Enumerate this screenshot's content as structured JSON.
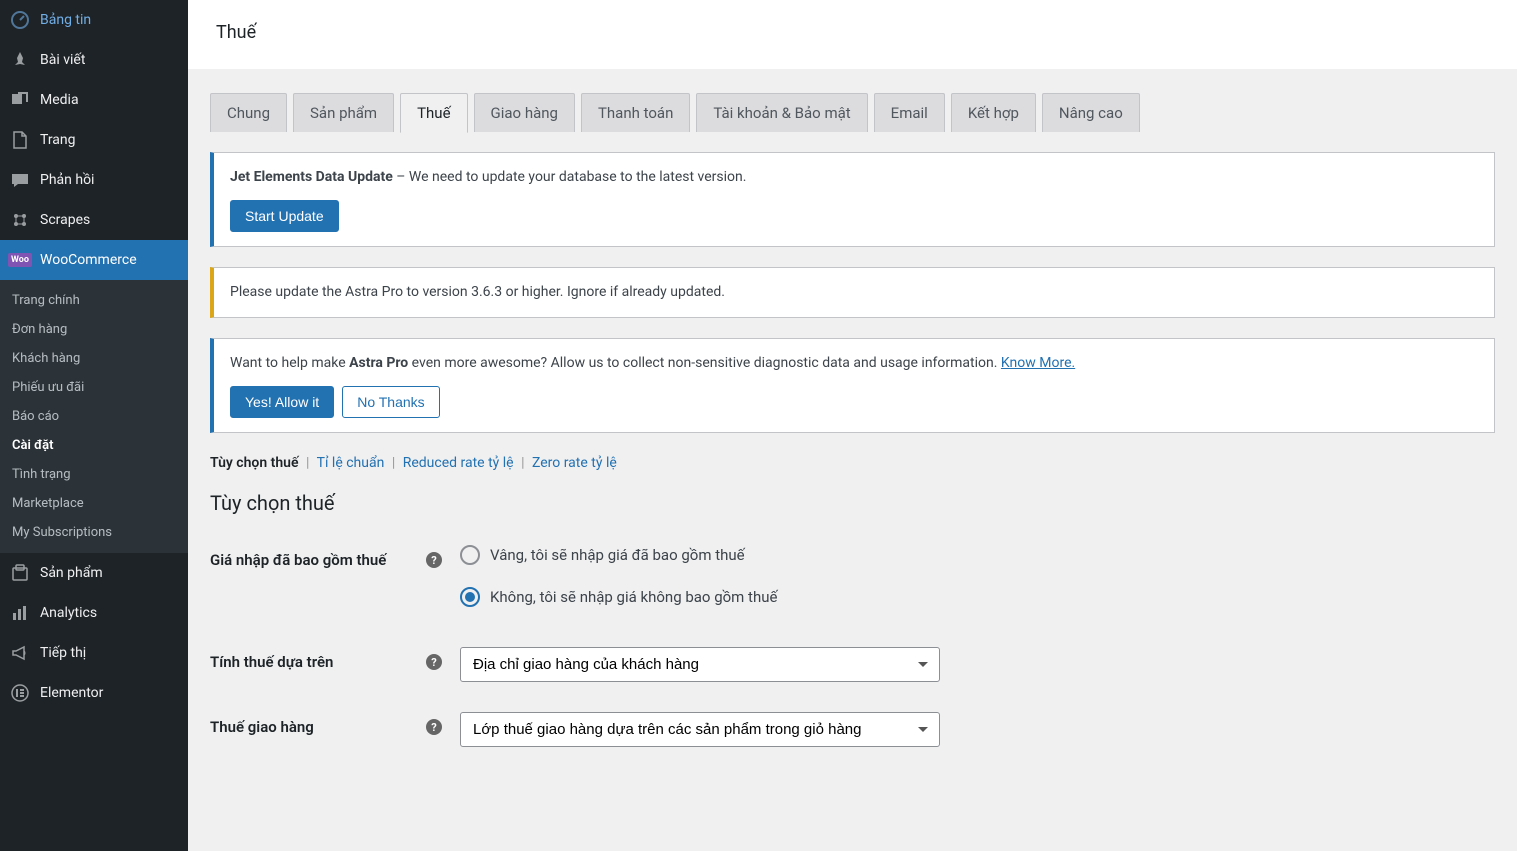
{
  "sidebar": {
    "items": [
      {
        "label": "Bảng tin",
        "icon": "dashboard"
      },
      {
        "label": "Bài viết",
        "icon": "pin"
      },
      {
        "label": "Media",
        "icon": "media"
      },
      {
        "label": "Trang",
        "icon": "page"
      },
      {
        "label": "Phản hồi",
        "icon": "comment"
      },
      {
        "label": "Scrapes",
        "icon": "scrapes"
      },
      {
        "label": "WooCommerce",
        "icon": "woo",
        "current": true
      },
      {
        "label": "Sản phẩm",
        "icon": "product"
      },
      {
        "label": "Analytics",
        "icon": "analytics"
      },
      {
        "label": "Tiếp thị",
        "icon": "marketing"
      },
      {
        "label": "Elementor",
        "icon": "elementor"
      }
    ],
    "submenu": [
      {
        "label": "Trang chính"
      },
      {
        "label": "Đơn hàng"
      },
      {
        "label": "Khách hàng"
      },
      {
        "label": "Phiếu ưu đãi"
      },
      {
        "label": "Báo cáo"
      },
      {
        "label": "Cài đặt",
        "current": true
      },
      {
        "label": "Tình trạng"
      },
      {
        "label": "Marketplace"
      },
      {
        "label": "My Subscriptions"
      }
    ]
  },
  "header": {
    "title": "Thuế"
  },
  "tabs": [
    {
      "label": "Chung"
    },
    {
      "label": "Sản phẩm"
    },
    {
      "label": "Thuế",
      "active": true
    },
    {
      "label": "Giao hàng"
    },
    {
      "label": "Thanh toán"
    },
    {
      "label": "Tài khoản & Bảo mật"
    },
    {
      "label": "Email"
    },
    {
      "label": "Kết hợp"
    },
    {
      "label": "Nâng cao"
    }
  ],
  "notices": {
    "jet": {
      "bold": "Jet Elements Data Update",
      "text": " – We need to update your database to the latest version.",
      "button": "Start Update"
    },
    "astra_update": {
      "text": "Please update the Astra Pro to version 3.6.3 or higher. Ignore if already updated."
    },
    "astra_allow": {
      "prefix": "Want to help make ",
      "bold": "Astra Pro",
      "suffix": " even more awesome? Allow us to collect non-sensitive diagnostic data and usage information. ",
      "link": "Know More.",
      "yes": "Yes! Allow it",
      "no": "No Thanks"
    }
  },
  "subnav": {
    "items": [
      {
        "label": "Tùy chọn thuế",
        "current": true
      },
      {
        "label": "Tỉ lệ chuẩn"
      },
      {
        "label": "Reduced rate tỷ lệ"
      },
      {
        "label": "Zero rate tỷ lệ"
      }
    ]
  },
  "section": {
    "title": "Tùy chọn thuế"
  },
  "form": {
    "prices_label": "Giá nhập đã bao gồm thuế",
    "prices_opt1": "Vâng, tôi sẽ nhập giá đã bao gồm thuế",
    "prices_opt2": "Không, tôi sẽ nhập giá không bao gồm thuế",
    "calc_label": "Tính thuế dựa trên",
    "calc_value": "Địa chỉ giao hàng của khách hàng",
    "ship_label": "Thuế giao hàng",
    "ship_value": "Lớp thuế giao hàng dựa trên các sản phẩm trong giỏ hàng"
  }
}
